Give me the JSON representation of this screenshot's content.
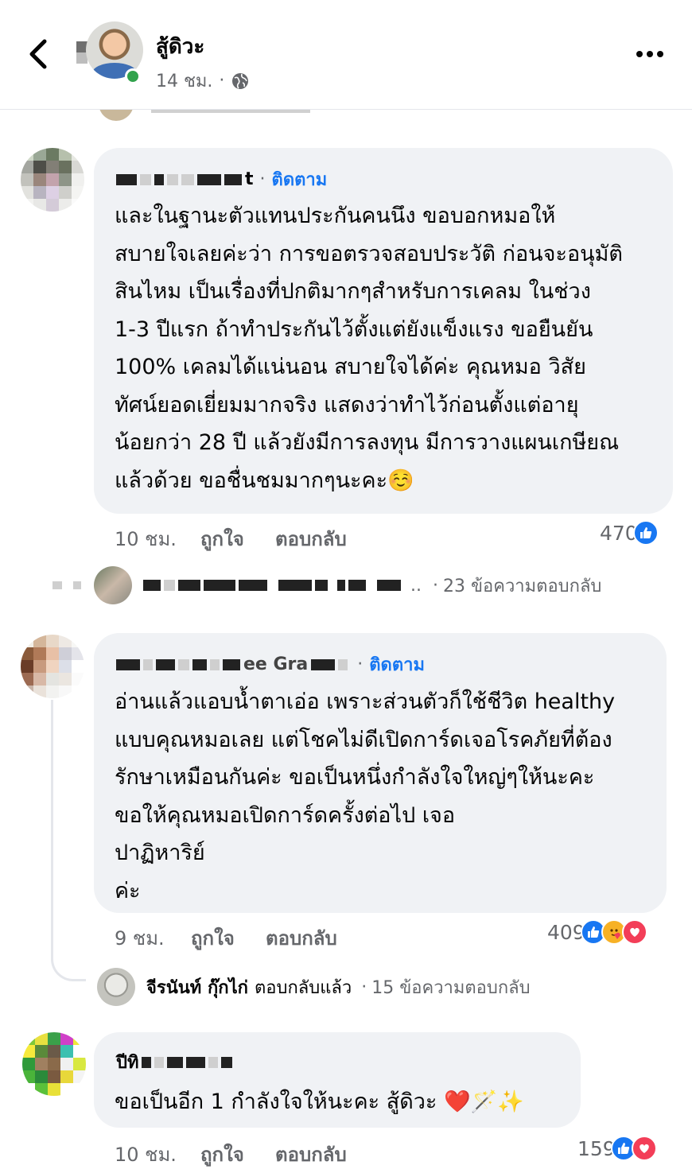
{
  "header": {
    "name": "สู้ดิวะ",
    "time": "14 ชม.",
    "separator": "·"
  },
  "comments": [
    {
      "author_visible": "t",
      "follow_label": "ติดตาม",
      "separator": "·",
      "text": "และในฐานะตัวแทนประกันคนนึง ขอบอกหมอให้\nสบายใจเลยค่ะว่า การขอตรวจสอบประวัติ ก่อนจะอนุมัติ\nสินไหม เป็นเรื่องที่ปกติมากๆสำหรับการเคลม ในช่วง\n1-3 ปีแรก ถ้าทำประกันไว้ตั้งแต่ยังแข็งแรง ขอยืนยัน\n100% เคลมได้แน่นอน สบายใจได้ค่ะ คุณหมอ วิสัย\nทัศน์ยอดเยี่ยมมากจริง แสดงว่าทำไว้ก่อนตั้งแต่อายุ\nน้อยกว่า 28 ปี แล้วยังมีการลงทุน มีการวางแผนเกษียณ\nแล้วด้วย ขอชื่นชมมากๆนะคะ",
      "emoji": "☺️",
      "time": "10 ชม.",
      "like_label": "ถูกใจ",
      "reply_label": "ตอบกลับ",
      "reaction_count": "470",
      "reply_summary": {
        "ellipsis": "..",
        "separator": "·",
        "text": "23 ข้อความตอบกลับ"
      }
    },
    {
      "author_visible": "ee Gra",
      "follow_label": "ติดตาม",
      "separator": "·",
      "text": "อ่านแล้วแอบน้ำตาเอ่อ เพราะส่วนตัวก็ใช้ชีวิต healthy\nแบบคุณหมอเลย แต่โชคไม่ดีเปิดการ์ดเจอโรคภัยที่ต้อง\nรักษาเหมือนกันค่ะ ขอเป็นหนึ่งกำลังใจใหญ่ๆให้นะคะ\nขอให้คุณหมอเปิดการ์ดครั้งต่อไป เจอ\nปาฏิหาริย์\nค่ะ",
      "time": "9 ชม.",
      "like_label": "ถูกใจ",
      "reply_label": "ตอบกลับ",
      "reaction_count": "409",
      "reply_summary": {
        "name": "จีรนันท์ กุ๊กไก่",
        "action": "ตอบกลับแล้ว",
        "separator": "·",
        "text": "15 ข้อความตอบกลับ"
      }
    },
    {
      "author_visible": "ปีทิ",
      "text": "ขอเป็นอีก 1 กำลังใจให้นะคะ สู้ดิวะ",
      "emoji": "❤️🪄✨",
      "time": "10 ชม.",
      "like_label": "ถูกใจ",
      "reply_label": "ตอบกลับ",
      "reaction_count": "159"
    }
  ],
  "icons": {
    "back": "chevron-left-icon",
    "globe": "globe-icon",
    "more": "more-horizontal-icon",
    "like": "like-reaction-icon",
    "care": "care-reaction-icon",
    "love": "love-reaction-icon"
  },
  "colors": {
    "accent": "#1877f2",
    "bubble": "#f0f2f5",
    "muted": "#65676b",
    "online": "#31a24c",
    "love": "#f33e58"
  }
}
